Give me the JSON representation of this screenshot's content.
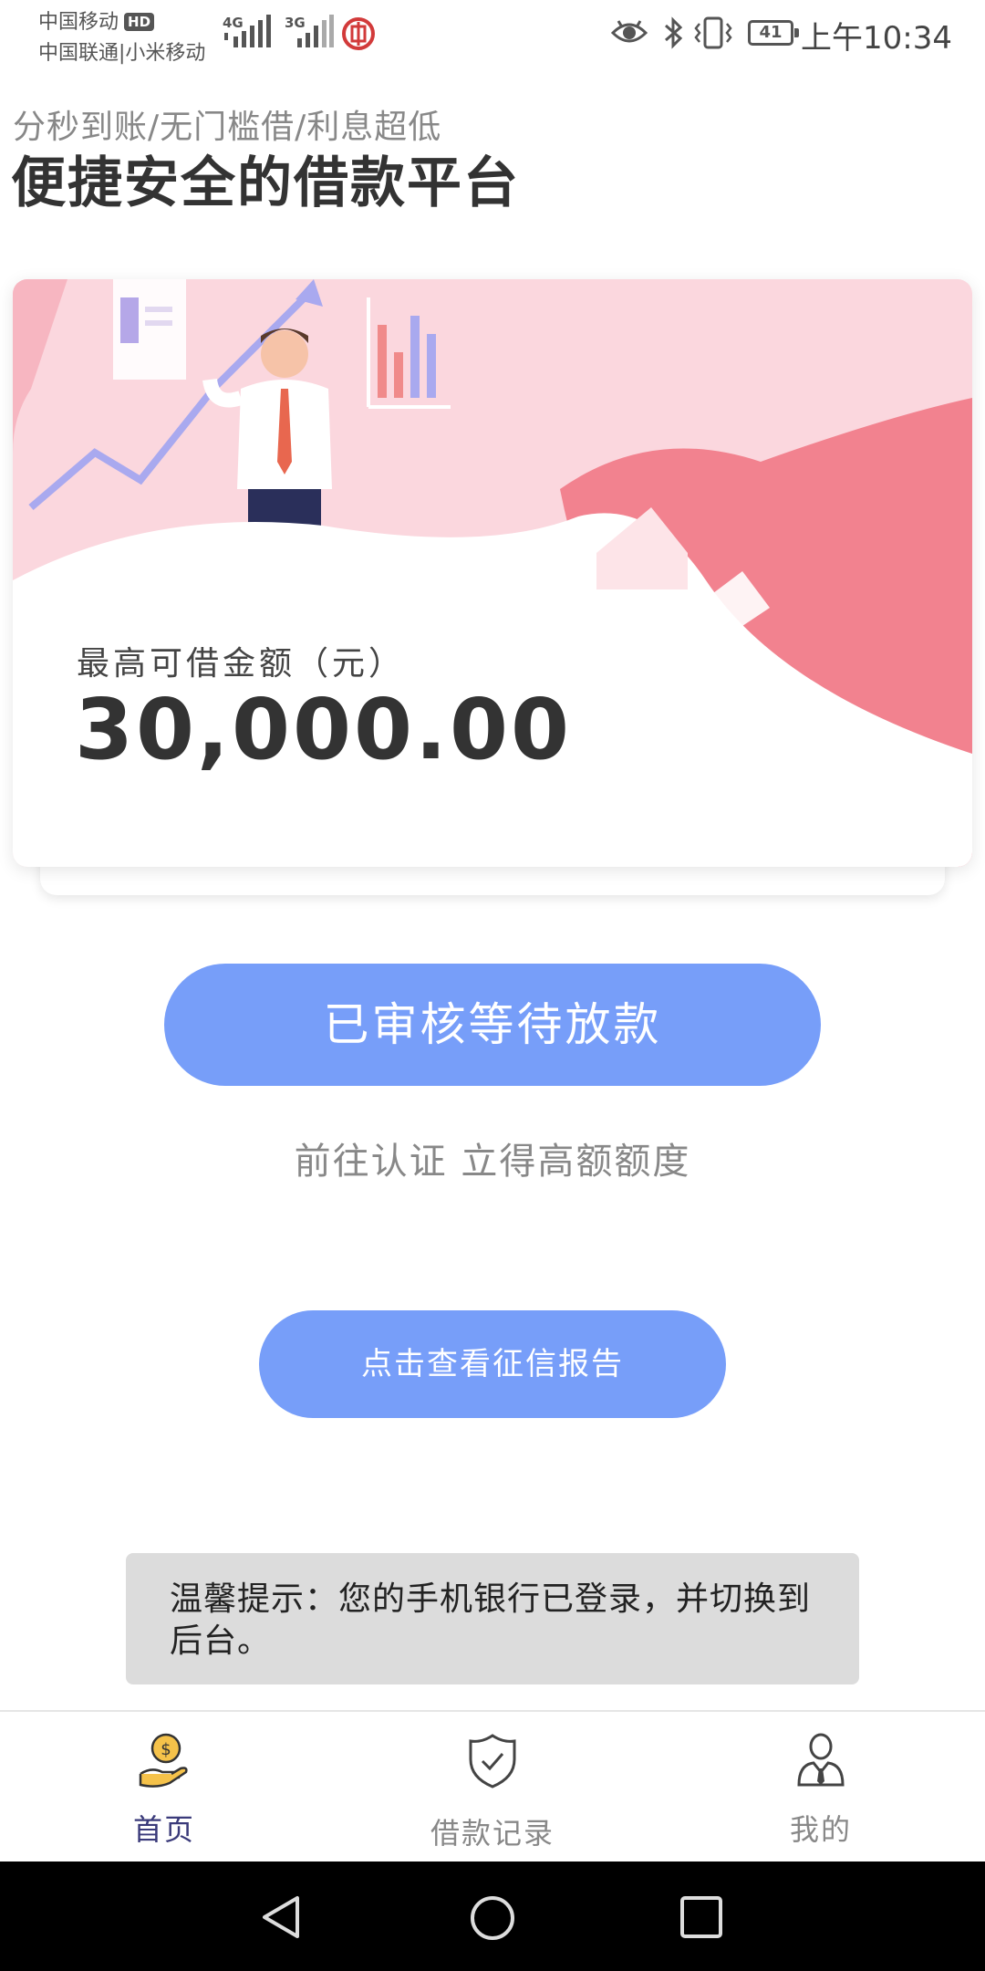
{
  "status_bar": {
    "carrier_1": "中国移动",
    "hd_badge": "HD",
    "carrier_2": "中国联通|小米移动",
    "signal_1_tag": "4G",
    "signal_2_tag": "3G",
    "battery": "41",
    "time": "上午10:34",
    "icons": [
      "eye-icon",
      "bluetooth-icon",
      "vibrate-icon",
      "bank-app-icon"
    ]
  },
  "header": {
    "subtitle": "分秒到账/无门槛借/利息超低",
    "title": "便捷安全的借款平台"
  },
  "hero": {
    "limit_label": "最高可借金额（元）",
    "limit_amount": "30,000.00"
  },
  "actions": {
    "main_button": "已审核等待放款",
    "promo_text": "前往认证 立得高额额度",
    "report_button": "点击查看征信报告"
  },
  "toast": {
    "text": "温馨提示：您的手机银行已登录，并切换到后台。"
  },
  "bottom_nav": {
    "items": [
      {
        "label": "首页",
        "icon": "money-hand-icon",
        "active": true
      },
      {
        "label": "借款记录",
        "icon": "shield-check-icon",
        "active": false
      },
      {
        "label": "我的",
        "icon": "user-icon",
        "active": false
      }
    ]
  },
  "colors": {
    "primary_button": "#779ef9",
    "hero_pink": "#fbd7de",
    "hero_accent": "#f2828f",
    "active_nav": "#3a3a7a",
    "toast_bg": "#dcdcdc"
  }
}
